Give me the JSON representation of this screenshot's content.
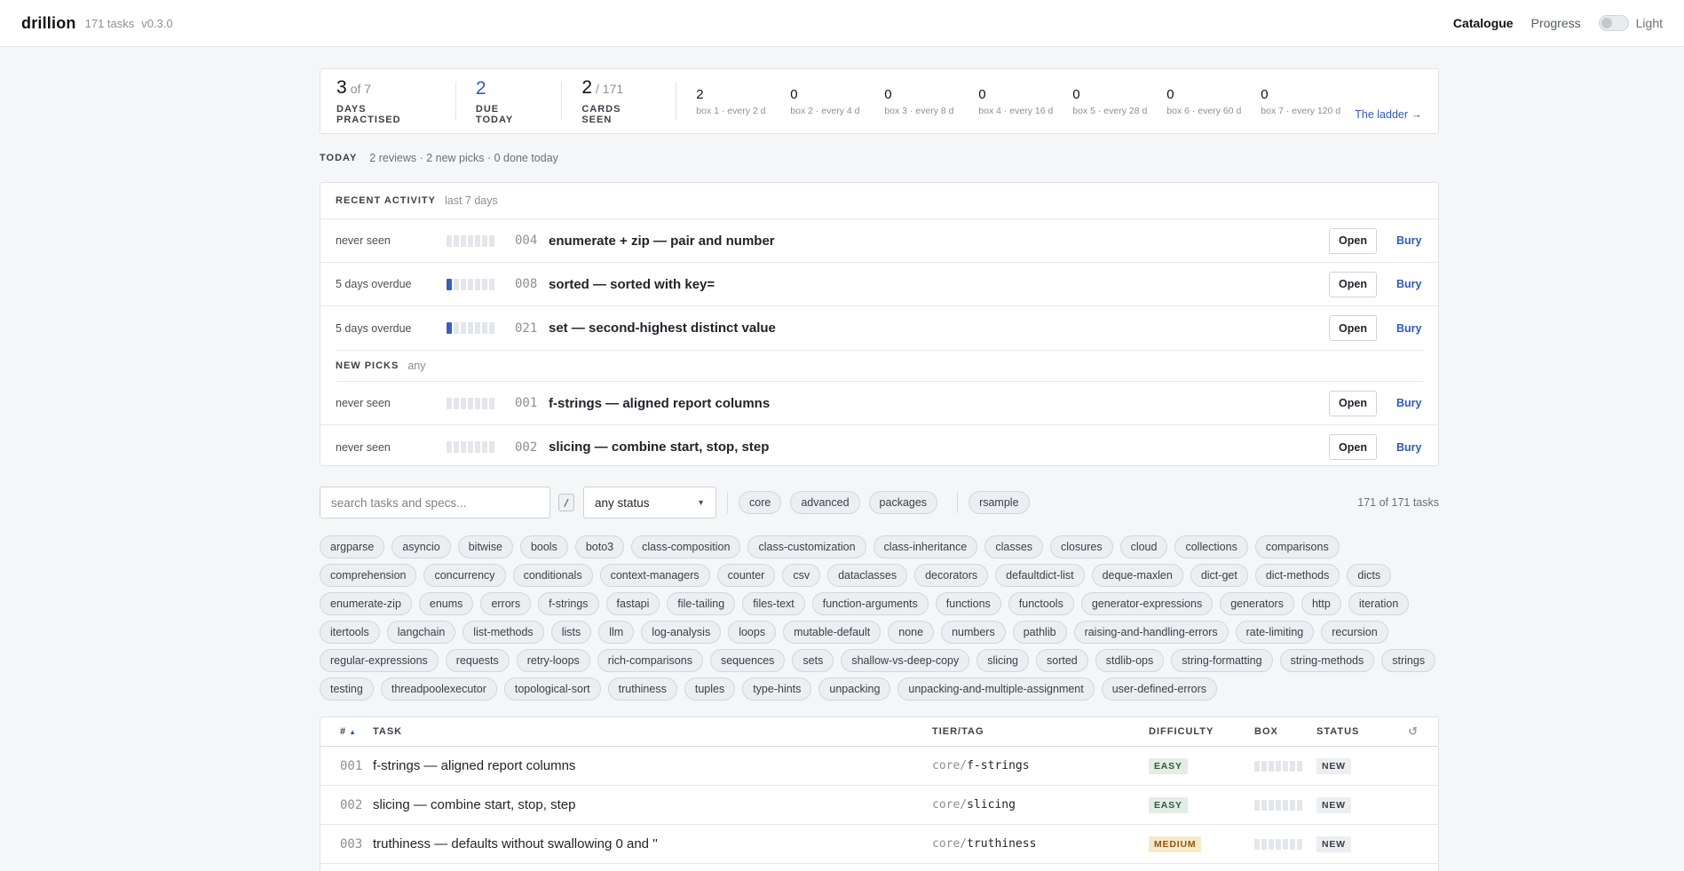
{
  "app": {
    "name": "drillion",
    "task_count": "171 tasks",
    "version": "v0.3.0"
  },
  "nav": {
    "catalogue": "Catalogue",
    "progress": "Progress",
    "theme": "Light"
  },
  "stats": {
    "days_practised": {
      "value": "3",
      "suffix": "of 7",
      "label": "DAYS PRACTISED"
    },
    "due_today": {
      "value": "2",
      "label": "DUE TODAY"
    },
    "cards_seen": {
      "value": "2",
      "suffix": "/ 171",
      "label": "CARDS SEEN"
    },
    "boxes": [
      {
        "count": "2",
        "label": "box 1 · every 2 d"
      },
      {
        "count": "0",
        "label": "box 2 · every 4 d"
      },
      {
        "count": "0",
        "label": "box 3 · every 8 d"
      },
      {
        "count": "0",
        "label": "box 4 · every 16 d"
      },
      {
        "count": "0",
        "label": "box 5 · every 28 d"
      },
      {
        "count": "0",
        "label": "box 6 · every 60 d"
      },
      {
        "count": "0",
        "label": "box 7 · every 120 d"
      }
    ],
    "ladder_link": "The ladder →"
  },
  "today": {
    "label": "TODAY",
    "summary": "2 reviews · 2 new picks · 0 done today"
  },
  "activity": {
    "title": "RECENT ACTIVITY",
    "subtitle": "last 7 days",
    "rows": [
      {
        "status": "never seen",
        "level": 0,
        "id": "004",
        "title": "enumerate + zip — pair and number",
        "open": "Open",
        "bury": "Bury"
      },
      {
        "status": "5 days overdue",
        "level": 1,
        "id": "008",
        "title": "sorted — sorted with key=",
        "open": "Open",
        "bury": "Bury"
      },
      {
        "status": "5 days overdue",
        "level": 1,
        "id": "021",
        "title": "set — second-highest distinct value",
        "open": "Open",
        "bury": "Bury"
      }
    ],
    "picks_title": "NEW PICKS",
    "picks_subtitle": "any",
    "picks": [
      {
        "status": "never seen",
        "level": 0,
        "id": "001",
        "title": "f-strings — aligned report columns",
        "open": "Open",
        "bury": "Bury"
      },
      {
        "status": "never seen",
        "level": 0,
        "id": "002",
        "title": "slicing — combine start, stop, step",
        "open": "Open",
        "bury": "Bury"
      }
    ]
  },
  "filters": {
    "search_placeholder": "search tasks and specs...",
    "shortcut": "/",
    "status_value": "any status",
    "tiers": [
      "core",
      "advanced",
      "packages",
      "rsample"
    ],
    "count": "171 of 171 tasks"
  },
  "tags": [
    "argparse",
    "asyncio",
    "bitwise",
    "bools",
    "boto3",
    "class-composition",
    "class-customization",
    "class-inheritance",
    "classes",
    "closures",
    "cloud",
    "collections",
    "comparisons",
    "comprehension",
    "concurrency",
    "conditionals",
    "context-managers",
    "counter",
    "csv",
    "dataclasses",
    "decorators",
    "defaultdict-list",
    "deque-maxlen",
    "dict-get",
    "dict-methods",
    "dicts",
    "enumerate-zip",
    "enums",
    "errors",
    "f-strings",
    "fastapi",
    "file-tailing",
    "files-text",
    "function-arguments",
    "functions",
    "functools",
    "generator-expressions",
    "generators",
    "http",
    "iteration",
    "itertools",
    "langchain",
    "list-methods",
    "lists",
    "llm",
    "log-analysis",
    "loops",
    "mutable-default",
    "none",
    "numbers",
    "pathlib",
    "raising-and-handling-errors",
    "rate-limiting",
    "recursion",
    "regular-expressions",
    "requests",
    "retry-loops",
    "rich-comparisons",
    "sequences",
    "sets",
    "shallow-vs-deep-copy",
    "slicing",
    "sorted",
    "stdlib-ops",
    "string-formatting",
    "string-methods",
    "strings",
    "testing",
    "threadpoolexecutor",
    "topological-sort",
    "truthiness",
    "tuples",
    "type-hints",
    "unpacking",
    "unpacking-and-multiple-assignment",
    "user-defined-errors"
  ],
  "table": {
    "headers": {
      "num": "#",
      "task": "TASK",
      "tier": "TIER/TAG",
      "difficulty": "DIFFICULTY",
      "box": "BOX",
      "status": "STATUS",
      "reset": "↺"
    },
    "rows": [
      {
        "id": "001",
        "task": "f-strings — aligned report columns",
        "tier": "core/",
        "tag": "f-strings",
        "difficulty": "EASY",
        "level": 0,
        "status": "NEW"
      },
      {
        "id": "002",
        "task": "slicing — combine start, stop, step",
        "tier": "core/",
        "tag": "slicing",
        "difficulty": "EASY",
        "level": 0,
        "status": "NEW"
      },
      {
        "id": "003",
        "task": "truthiness — defaults without swallowing 0 and ''",
        "tier": "core/",
        "tag": "truthiness",
        "difficulty": "MEDIUM",
        "level": 0,
        "status": "NEW"
      }
    ]
  },
  "colors": {
    "accent": "#2f5bb5",
    "box_filled": "#3a5fbf",
    "easy_bg": "#e4ece6",
    "medium_bg": "#f6e8c9"
  }
}
